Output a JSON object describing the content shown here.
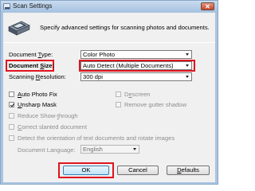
{
  "window": {
    "title": "Scan Settings",
    "close_glyph": "✕"
  },
  "header": {
    "description": "Specify advanced settings for scanning photos and documents."
  },
  "fields": {
    "document_type": {
      "label_pre": "Document ",
      "label_ul": "T",
      "label_post": "ype:",
      "value": "Color Photo"
    },
    "document_size": {
      "label_pre": "Document ",
      "label_ul": "S",
      "label_post": "ize:",
      "value": "Auto Detect (Multiple Documents)"
    },
    "scanning_resolution": {
      "label_pre": "Scanning ",
      "label_ul": "R",
      "label_post": "esolution:",
      "value": "300 dpi"
    }
  },
  "options": {
    "auto_photo_fix": {
      "pre": "",
      "ul": "A",
      "post": "uto Photo Fix",
      "checked": false,
      "enabled": true
    },
    "unsharp_mask": {
      "pre": "",
      "ul": "U",
      "post": "nsharp Mask",
      "checked": true,
      "enabled": true
    },
    "reduce_show_through": {
      "pre": "Reduce Show-",
      "ul": "t",
      "post": "hrough",
      "checked": false,
      "enabled": false
    },
    "correct_slanted": {
      "pre": "",
      "ul": "C",
      "post": "orrect slanted document",
      "checked": false,
      "enabled": false
    },
    "detect_orientation": {
      "pre": "",
      "ul": "",
      "post": "Detect the orientation of text documents and rotate images",
      "checked": false,
      "enabled": false
    },
    "descreen": {
      "pre": "D",
      "ul": "e",
      "post": "screen",
      "checked": false,
      "enabled": false
    },
    "remove_gutter_shadow": {
      "pre": "Remove gutter shadow",
      "ul": "",
      "post": "",
      "checked": false,
      "enabled": false
    }
  },
  "document_language": {
    "label": "Document Language:",
    "value": "English"
  },
  "buttons": {
    "ok": "OK",
    "cancel": "Cancel",
    "defaults_ul": "D",
    "defaults_post": "efaults"
  },
  "colors": {
    "highlight": "#e0141e",
    "title_bar": "#a6c1e0",
    "dialog_bg": "#f0f0f0"
  },
  "icons": [
    "app-icon",
    "close-icon",
    "scanner-icon",
    "dropdown-arrow-icon",
    "checkbox-checkmark-icon"
  ]
}
